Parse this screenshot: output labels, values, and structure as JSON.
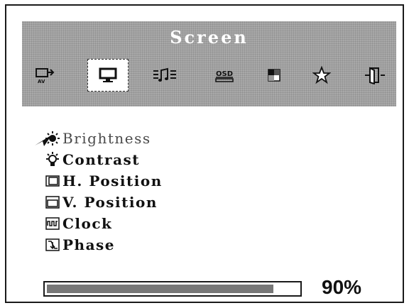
{
  "osd": {
    "title": "Screen",
    "tabs": [
      {
        "icon": "input-source-icon"
      },
      {
        "icon": "monitor-screen-icon",
        "selected": true
      },
      {
        "icon": "audio-icon"
      },
      {
        "icon": "osd-settings-icon",
        "text": "OSD"
      },
      {
        "icon": "color-icon"
      },
      {
        "icon": "favorite-star-icon"
      },
      {
        "icon": "exit-icon"
      }
    ],
    "menu": {
      "items": [
        {
          "label": "Brightness",
          "icon": "brightness-icon",
          "active": true
        },
        {
          "label": "Contrast",
          "icon": "contrast-icon"
        },
        {
          "label": "H. Position",
          "icon": "h-position-icon"
        },
        {
          "label": "V. Position",
          "icon": "v-position-icon"
        },
        {
          "label": "Clock",
          "icon": "clock-icon"
        },
        {
          "label": "Phase",
          "icon": "phase-icon"
        }
      ]
    },
    "level": {
      "value": 90,
      "label": "90%"
    }
  },
  "colors": {
    "header_bg": "#a9a9a9",
    "title": "#ffffff",
    "progress_fill": "#777777",
    "frame": "#1a1a1a"
  }
}
